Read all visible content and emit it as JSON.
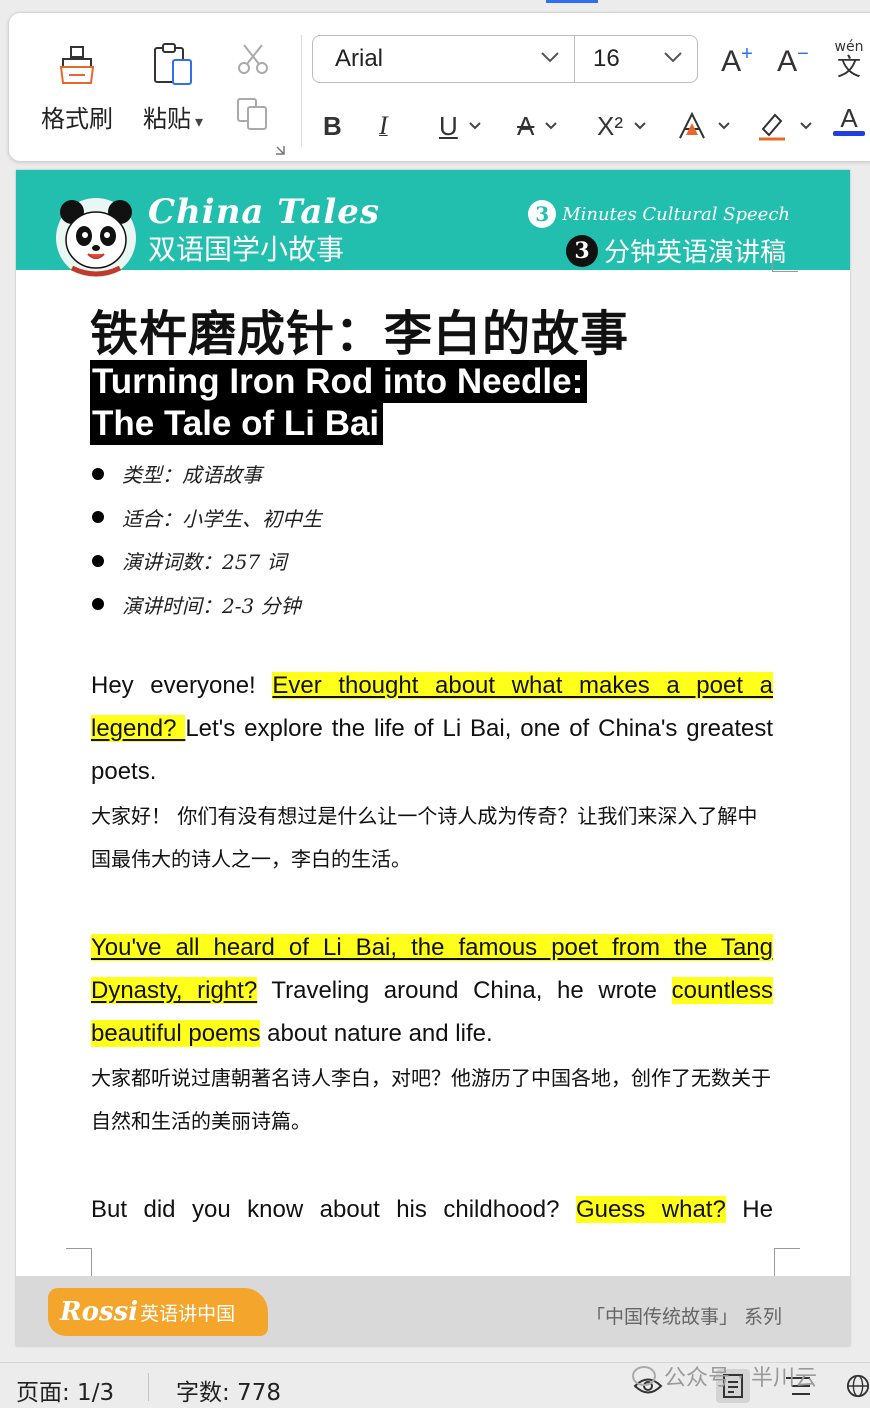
{
  "toolbar": {
    "format_painter_label": "格式刷",
    "paste_label": "粘贴",
    "font_name": "Arial",
    "font_size": "16",
    "superscript_label": "X²",
    "pinyin_label": "wén"
  },
  "banner": {
    "brand_en": "China Tales",
    "brand_zh": "双语国学小故事",
    "speech_en_num": "3",
    "speech_en": "Minutes Cultural Speech",
    "speech_zh_num": "3",
    "speech_zh": "分钟英语演讲稿"
  },
  "doc": {
    "title_zh": "铁杵磨成针：李白的故事",
    "title_en_line1": "Turning Iron Rod into Needle:",
    "title_en_line2": "The Tale of Li Bai",
    "bullets": [
      "类型：成语故事",
      "适合：小学生、初中生",
      "演讲词数：257 词",
      "演讲时间：2-3 分钟"
    ],
    "p1": {
      "a": "Hey everyone! ",
      "b": "Ever thought about what makes a poet a legend? ",
      "c": "Let's explore the life of Li Bai, one of China's greatest poets.",
      "zh": "大家好！ 你们有没有想过是什么让一个诗人成为传奇？让我们来深入了解中国最伟大的诗人之一，李白的生活。"
    },
    "p2": {
      "a": "You've all heard of Li Bai, the famous poet from the Tang Dynasty, right?",
      "b": " Traveling around China, he wrote ",
      "c": "countless beautiful poems",
      "d": " about nature and life.",
      "zh": "大家都听说过唐朝著名诗人李白，对吧？他游历了中国各地，创作了无数关于自然和生活的美丽诗篇。"
    },
    "p3": {
      "a": "But did you know about his childhood? ",
      "b": "Guess what?",
      "c": " He"
    },
    "footer_brand_1": "Rossi",
    "footer_brand_2": "英语讲中国",
    "footer_series": "「中国传统故事」 系列"
  },
  "status": {
    "page": "页面: 1/3",
    "word_count": "字数: 778",
    "watermark": "公众号 · 半川云"
  },
  "colors": {
    "banner": "#23bfae",
    "highlight": "#ffff1a",
    "footer_band": "#d9d9d9",
    "rossi": "#f4a52c",
    "font_color_bar": "#1f3fe0"
  }
}
